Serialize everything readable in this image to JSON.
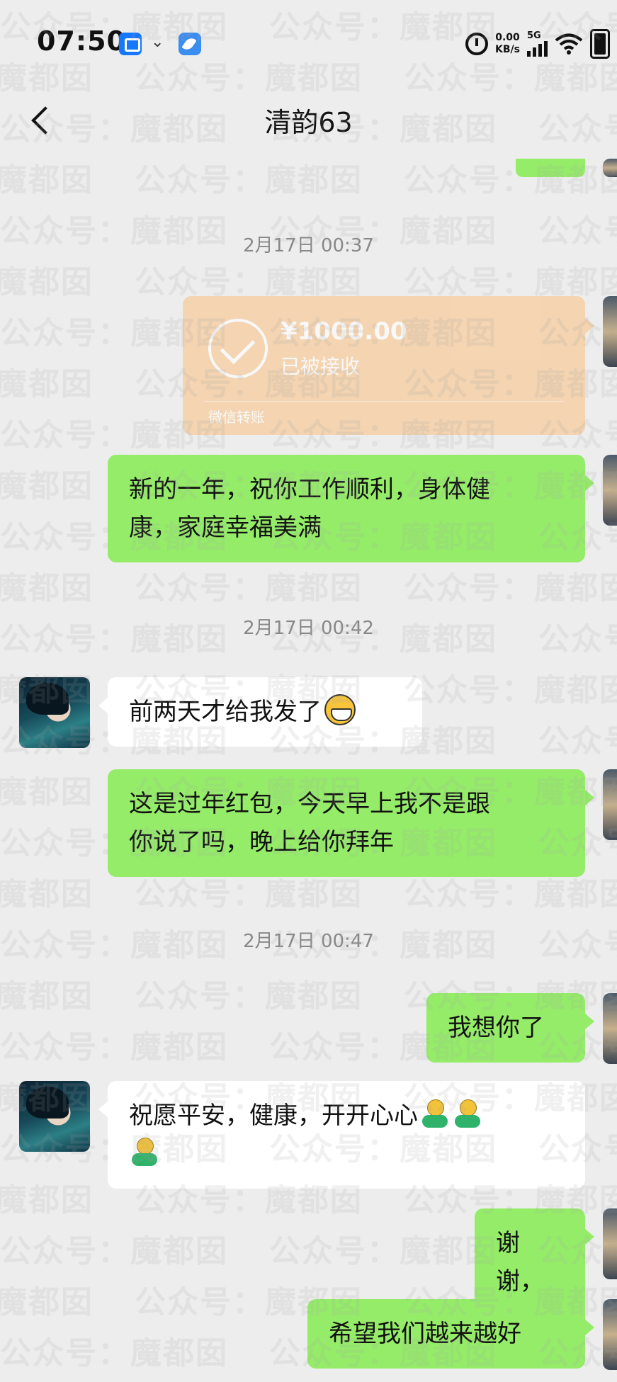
{
  "status_bar": {
    "time": "07:50",
    "net_speed_value": "0.00",
    "net_speed_unit": "KB/s",
    "network_type": "5G",
    "icons": [
      "app-notification-icon",
      "download-arrow-icon",
      "app-icon",
      "alarm-icon",
      "signal-icon",
      "wifi-icon",
      "battery-icon"
    ]
  },
  "nav": {
    "title": "清韵63"
  },
  "transfer": {
    "amount": "¥1000.00",
    "status": "已被接收",
    "label": "微信转账"
  },
  "timestamps": [
    "2月17日 00:37",
    "2月17日 00:42",
    "2月17日 00:47"
  ],
  "messages": [
    {
      "from": "me",
      "lines": [
        "新的一年，祝你工作顺利，身体健",
        "康，家庭幸福美满"
      ]
    },
    {
      "from": "them",
      "lines": [
        "前两天才给我发了"
      ],
      "emoji": "grin"
    },
    {
      "from": "me",
      "lines": [
        "这是过年红包，今天早上我不是跟",
        "你说了吗，晚上给你拜年"
      ]
    },
    {
      "from": "me",
      "lines": [
        "我想你了"
      ]
    },
    {
      "from": "them",
      "lines": [
        "祝愿平安，健康，开开心心"
      ],
      "emoji": "doll x3"
    },
    {
      "from": "me",
      "lines": [
        "谢谢，"
      ]
    },
    {
      "from": "me",
      "lines": [
        "希望我们越来越好"
      ]
    }
  ],
  "watermark": "公众号：魔都囡",
  "colors": {
    "background": "#ededed",
    "my_bubble": "#95ec69",
    "their_bubble": "#ffffff",
    "transfer_card": "#f9c892"
  }
}
